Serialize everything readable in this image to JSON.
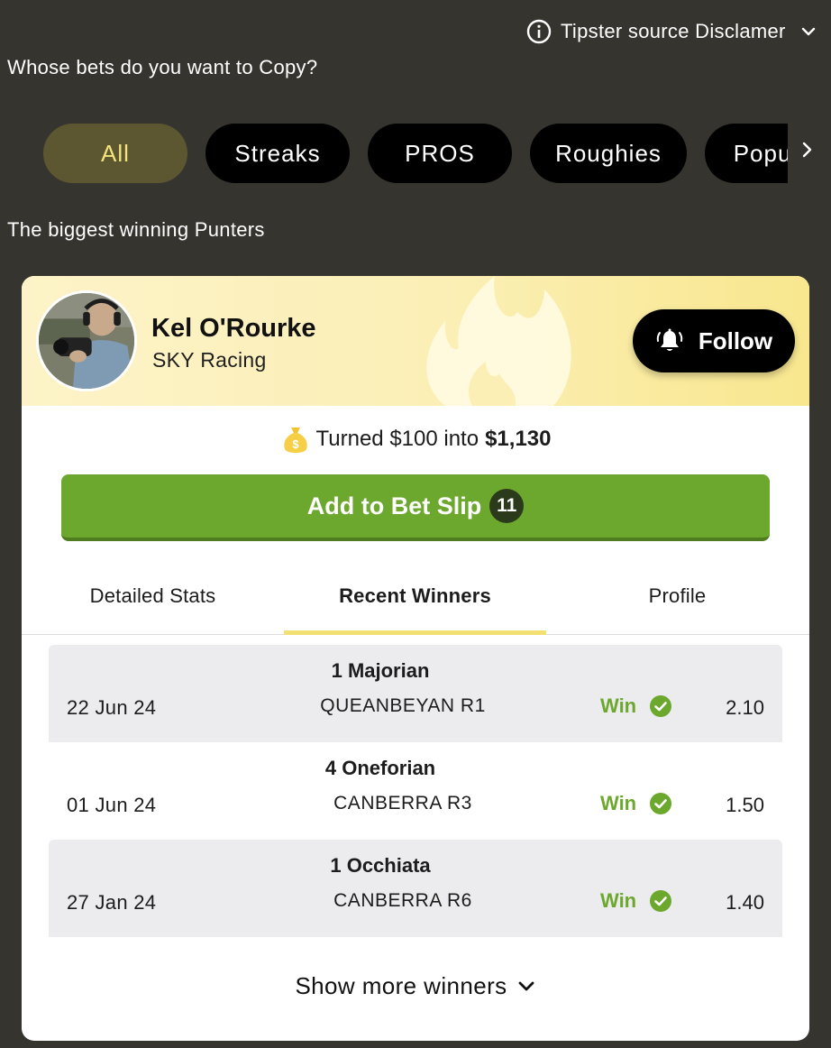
{
  "disclaimer": {
    "label": "Tipster source Disclamer",
    "icon": "info-icon"
  },
  "question": "Whose bets do you want to Copy?",
  "filters": [
    {
      "label": "All",
      "active": true
    },
    {
      "label": "Streaks",
      "active": false
    },
    {
      "label": "PROS",
      "active": false
    },
    {
      "label": "Roughies",
      "active": false
    },
    {
      "label": "Popular",
      "active": false
    }
  ],
  "section_title": "The biggest winning Punters",
  "tipster": {
    "name": "Kel O'Rourke",
    "source": "SKY Racing",
    "follow_label": "Follow",
    "turned_prefix": "Turned $100 into",
    "turned_amount": "$1,130",
    "bet_slip_label": "Add to Bet Slip",
    "bet_slip_count": "11"
  },
  "tabs": [
    {
      "label": "Detailed Stats",
      "active": false
    },
    {
      "label": "Recent Winners",
      "active": true
    },
    {
      "label": "Profile",
      "active": false
    }
  ],
  "winners": [
    {
      "horse": "1 Majorian",
      "date": "22 Jun 24",
      "race": "QUEANBEYAN R1",
      "result": "Win",
      "odds": "2.10"
    },
    {
      "horse": "4 Oneforian",
      "date": "01 Jun 24",
      "race": "CANBERRA R3",
      "result": "Win",
      "odds": "1.50"
    },
    {
      "horse": "1 Occhiata",
      "date": "27 Jan 24",
      "race": "CANBERRA R6",
      "result": "Win",
      "odds": "1.40"
    }
  ],
  "show_more_label": "Show more winners",
  "colors": {
    "background": "#36342f",
    "accent_yellow": "#f5e47b",
    "win_green": "#6ca72e",
    "tab_underline": "#f2e073"
  }
}
